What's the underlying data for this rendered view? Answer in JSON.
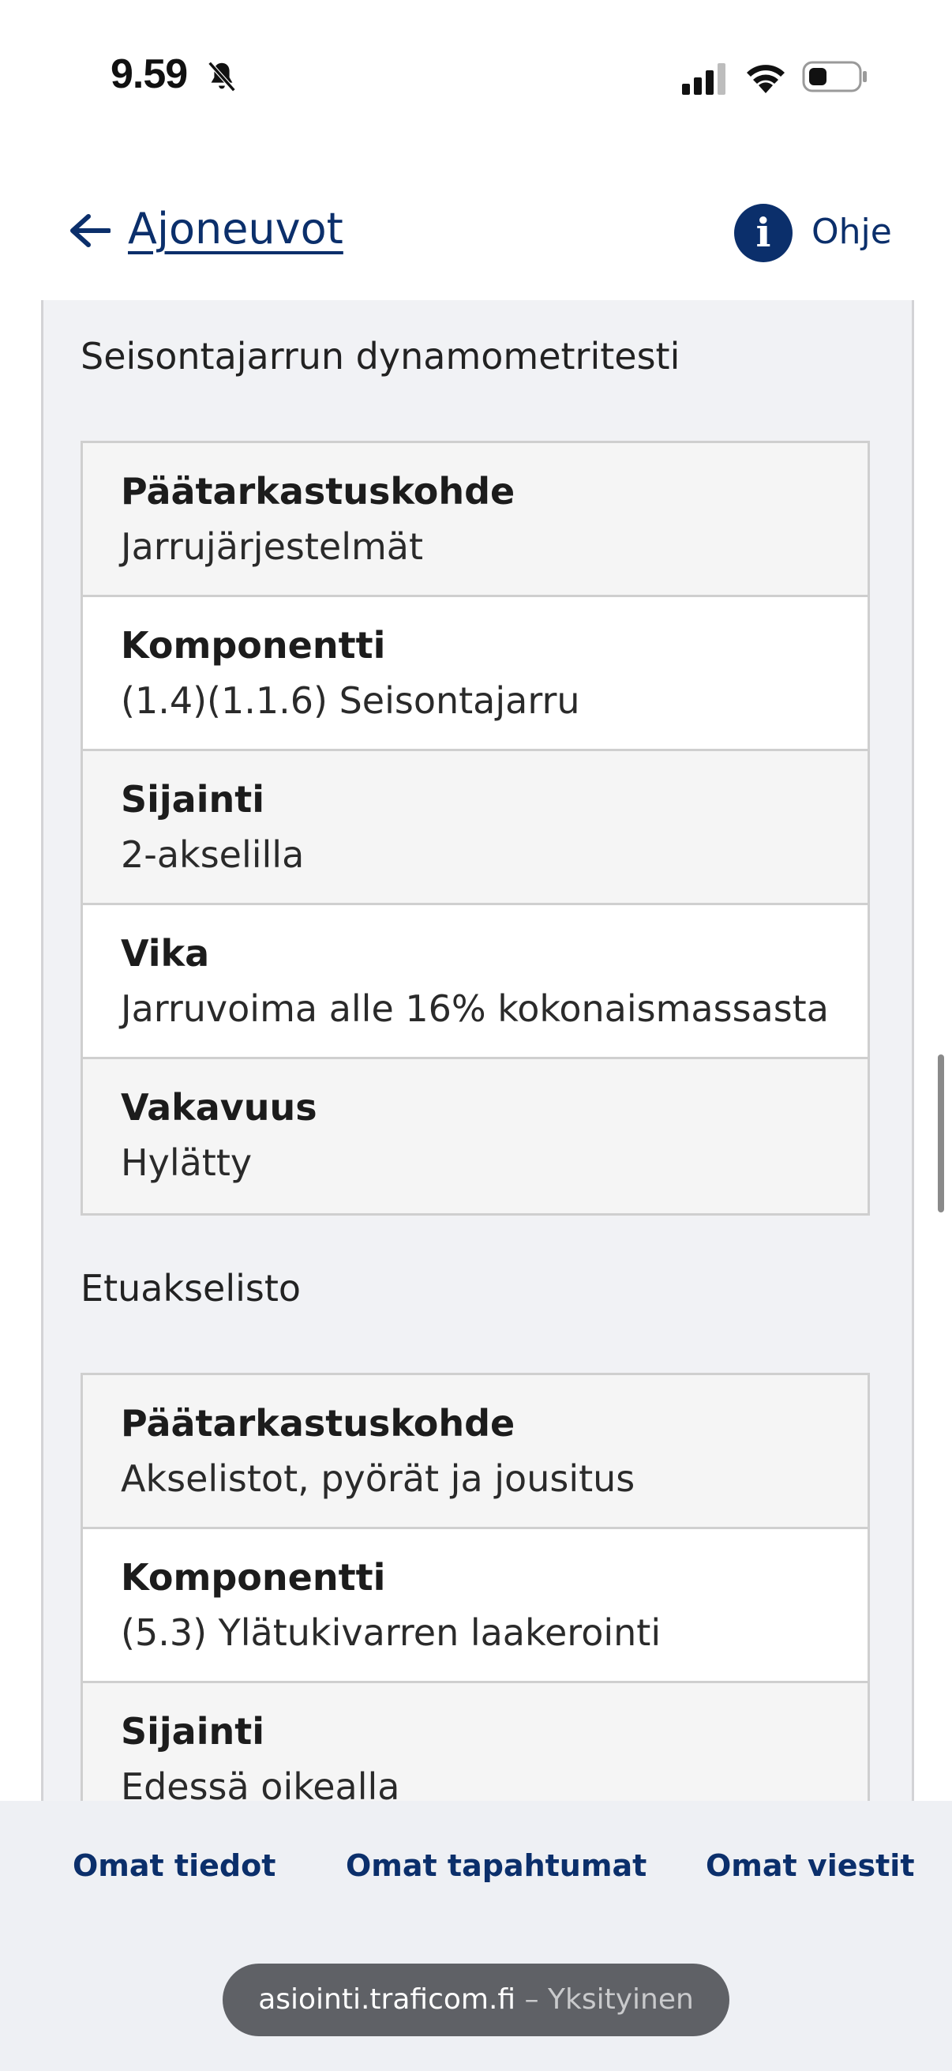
{
  "status_bar": {
    "time": "9.59",
    "icons": [
      "bell-slash-icon",
      "cellular-signal-icon",
      "wifi-icon",
      "battery-icon"
    ]
  },
  "header": {
    "back_label": "Ajoneuvot",
    "help_label": "Ohje",
    "help_icon_glyph": "i"
  },
  "sections": [
    {
      "title": "Seisontajarrun dynamometritesti",
      "rows": [
        {
          "label": "Päätarkastuskohde",
          "value": "Jarrujärjestelmät"
        },
        {
          "label": "Komponentti",
          "value": "(1.4)(1.1.6) Seisontajarru"
        },
        {
          "label": "Sijainti",
          "value": "2-akselilla"
        },
        {
          "label": "Vika",
          "value": "Jarruvoima alle 16% kokonaismassasta"
        },
        {
          "label": "Vakavuus",
          "value": "Hylätty"
        }
      ]
    },
    {
      "title": "Etuakselisto",
      "rows": [
        {
          "label": "Päätarkastuskohde",
          "value": "Akselistot, pyörät ja jousitus"
        },
        {
          "label": "Komponentti",
          "value": "(5.3) Ylätukivarren laakerointi"
        },
        {
          "label": "Sijainti",
          "value": "Edessä oikealla"
        }
      ]
    }
  ],
  "bottom_tabs": [
    "Omat tiedot",
    "Omat tapahtumat",
    "Omat viestit"
  ],
  "browser": {
    "domain": "asiointi.traficom.fi",
    "mode": "– Yksityinen"
  },
  "colors": {
    "brand": "#0b2f6b",
    "panel": "#f1f2f5",
    "border": "#cfcfcf"
  }
}
